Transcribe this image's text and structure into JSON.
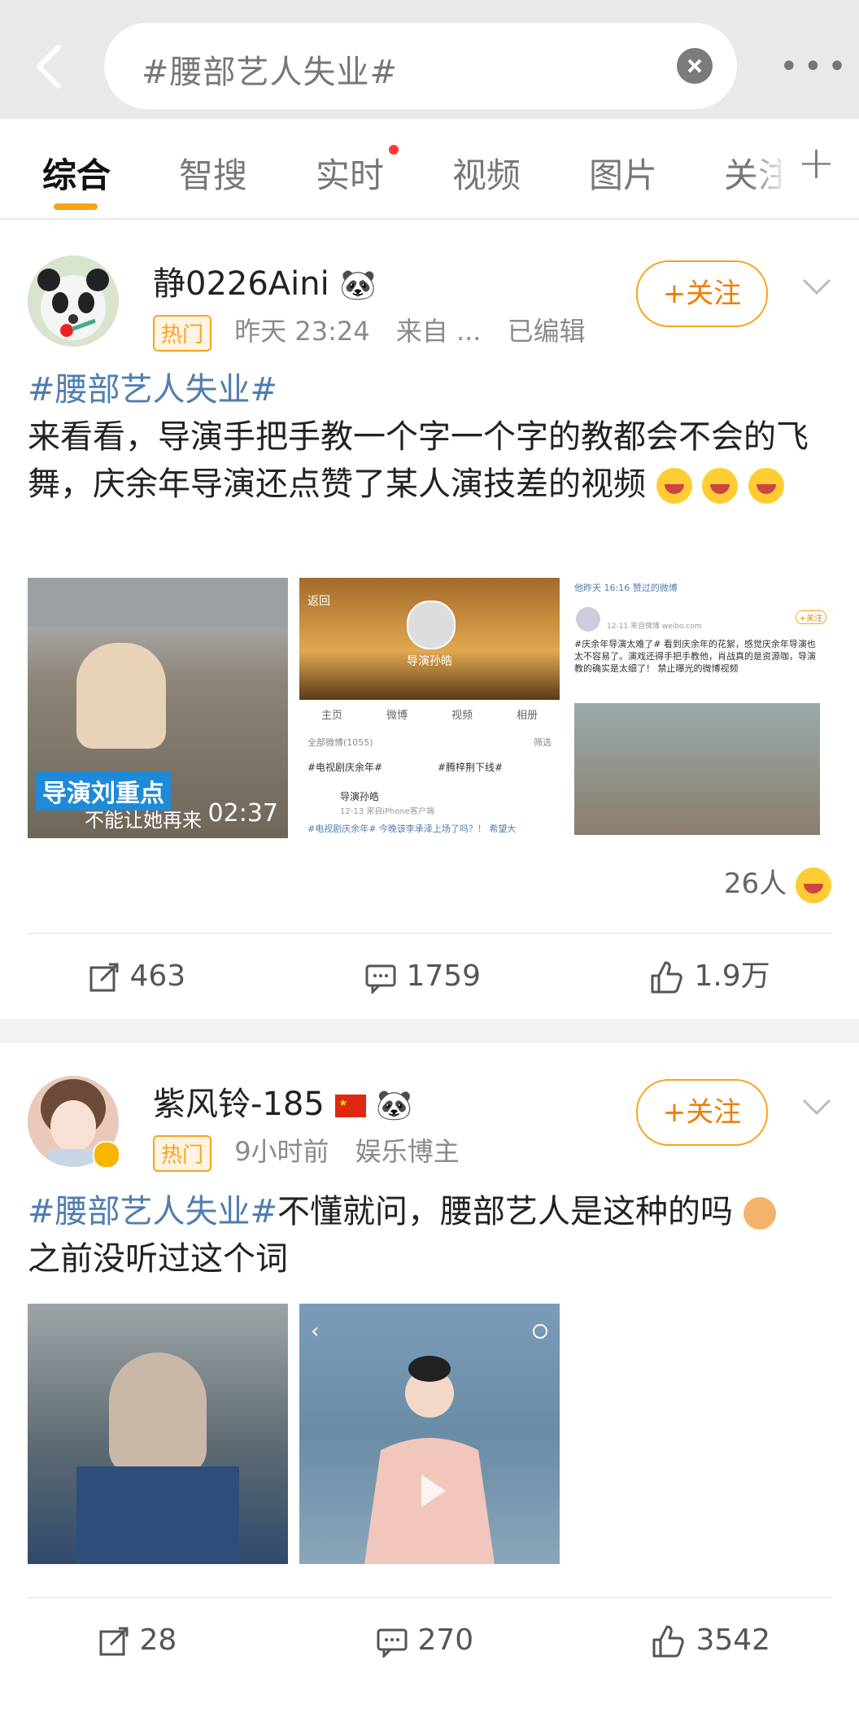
{
  "search": {
    "query": "#腰部艺人失业#"
  },
  "tabs": [
    {
      "label": "综合"
    },
    {
      "label": "智搜"
    },
    {
      "label": "实时"
    },
    {
      "label": "视频"
    },
    {
      "label": "图片"
    },
    {
      "label": "关注"
    }
  ],
  "posts": [
    {
      "username": "静0226Aini",
      "badge": "热门",
      "time": "昨天 23:24",
      "source": "来自 ...",
      "edited": "已编辑",
      "follow_label": "+关注",
      "tag": "#腰部艺人失业#",
      "text": "来看看，导演手把手教一个字一个字的教都会不会的飞舞，庆余年导演还点赞了某人演技差的视频",
      "images": [
        {
          "overlay_title": "导演刘重点",
          "overlay_sub": "不能让她再来",
          "duration": "02:37"
        },
        {
          "back": "返回",
          "name": "导演孙皓",
          "nav": [
            "主页",
            "微博",
            "视频",
            "相册"
          ],
          "count": "全部微博(1055)",
          "filter": "筛选",
          "tags": [
            "#电视剧庆余年#",
            "#腾梓荆下线#"
          ],
          "poster": "导演孙皓",
          "poster_meta": "12-13 来自iPhone客户端",
          "snippet": "#电视剧庆余年# 今晚该李承泽上场了吗？！ 希望大"
        },
        {
          "header": "他昨天 16:16 赞过的微博",
          "time": "12-11 来自微博 weibo.com",
          "follow": "+关注",
          "text": "#庆余年导演太难了# 看到庆余年的花絮，感觉庆余年导演也太不容易了。演戏还得手把手教他，肖战真的是资源咖，导演教的确实是太细了！ 禁止曝光的微博视频"
        }
      ],
      "reactions_count": "26人",
      "reposts": "463",
      "comments": "1759",
      "likes": "1.9万"
    },
    {
      "username": "紫风铃-185",
      "badge": "热门",
      "time": "9小时前",
      "source": "娱乐博主",
      "follow_label": "+关注",
      "tag": "#腰部艺人失业#",
      "text": "不懂就问，腰部艺人是这种的吗",
      "text2": "之前没听过这个词",
      "reposts": "28",
      "comments": "270",
      "likes": "3542"
    }
  ],
  "colors": {
    "accent": "#f7a31c",
    "tag": "#507daf"
  }
}
